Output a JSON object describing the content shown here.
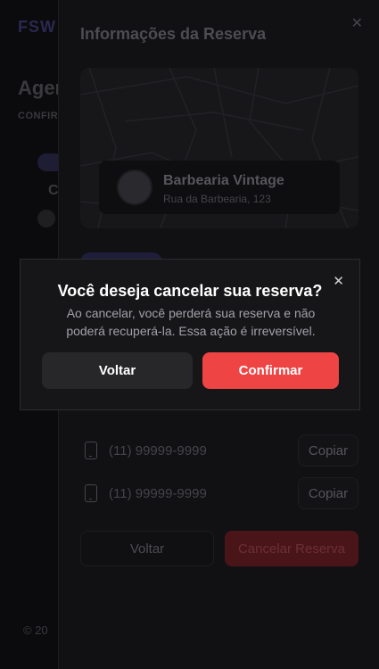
{
  "background": {
    "logo": "FSW",
    "heading": "Agen",
    "subheading": "CONFIR",
    "letter": "C",
    "footer": "© 20"
  },
  "sheet": {
    "title": "Informações da Reserva",
    "close_icon": "close-icon",
    "shop": {
      "name": "Barbearia Vintage",
      "address": "Rua da Barbearia, 123"
    },
    "phones": [
      {
        "number": "(11) 99999-9999",
        "copy_label": "Copiar"
      },
      {
        "number": "(11) 99999-9999",
        "copy_label": "Copiar"
      }
    ],
    "back_label": "Voltar",
    "cancel_label": "Cancelar Reserva"
  },
  "dialog": {
    "title": "Você deseja cancelar sua reserva?",
    "description": "Ao cancelar, você perderá sua reserva e não poderá recuperá-la. Essa ação é irreversível.",
    "back_label": "Voltar",
    "confirm_label": "Confirmar",
    "close_icon": "close-icon"
  },
  "colors": {
    "confirm": "#ef4444",
    "dialog_bg": "#161618",
    "secondary_button": "#27272a"
  }
}
